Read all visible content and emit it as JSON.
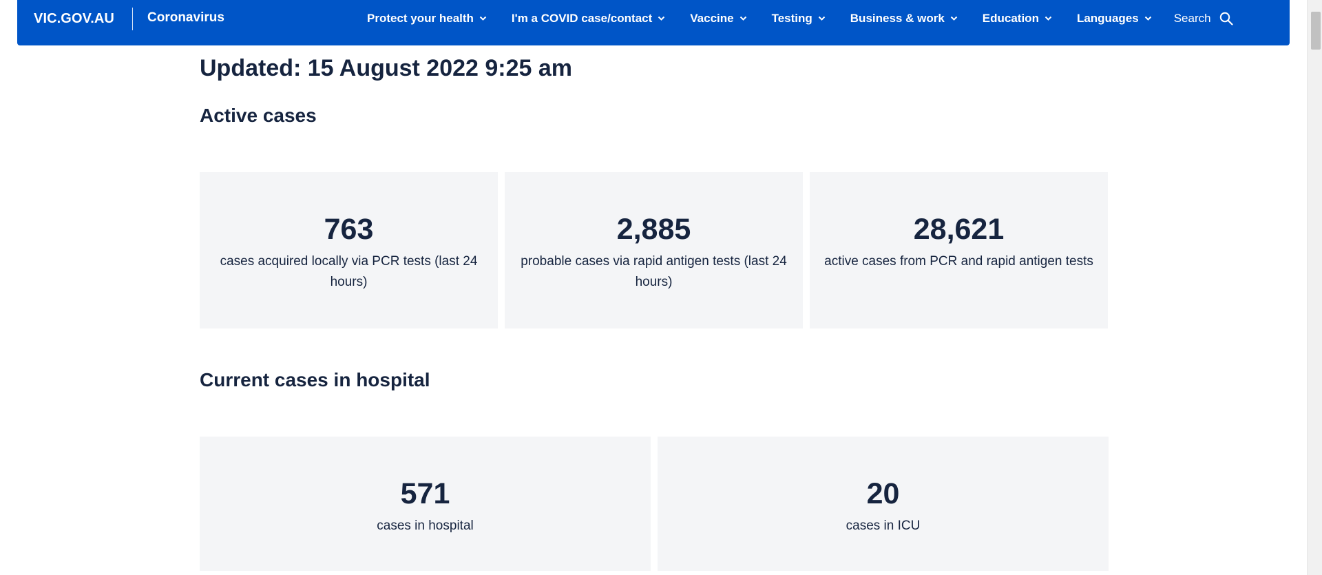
{
  "header": {
    "brand": "VIC.GOV.AU",
    "section": "Coronavirus",
    "nav": [
      {
        "label": "Protect your health"
      },
      {
        "label": "I'm a COVID case/contact"
      },
      {
        "label": "Vaccine"
      },
      {
        "label": "Testing"
      },
      {
        "label": "Business & work"
      },
      {
        "label": "Education"
      },
      {
        "label": "Languages"
      }
    ],
    "search_label": "Search",
    "bg_color": "#0055c7"
  },
  "main": {
    "updated": "Updated: 15 August 2022 9:25 am",
    "active_cases": {
      "title": "Active cases",
      "cards": [
        {
          "value": "763",
          "desc": "cases acquired locally via PCR tests (last 24 hours)"
        },
        {
          "value": "2,885",
          "desc": "probable cases via rapid antigen tests (last 24 hours)"
        },
        {
          "value": "28,621",
          "desc": "active cases from PCR and rapid antigen tests"
        }
      ]
    },
    "hospital": {
      "title": "Current cases in hospital",
      "cards": [
        {
          "value": "571",
          "desc": "cases in hospital"
        },
        {
          "value": "20",
          "desc": "cases in ICU"
        }
      ]
    }
  }
}
